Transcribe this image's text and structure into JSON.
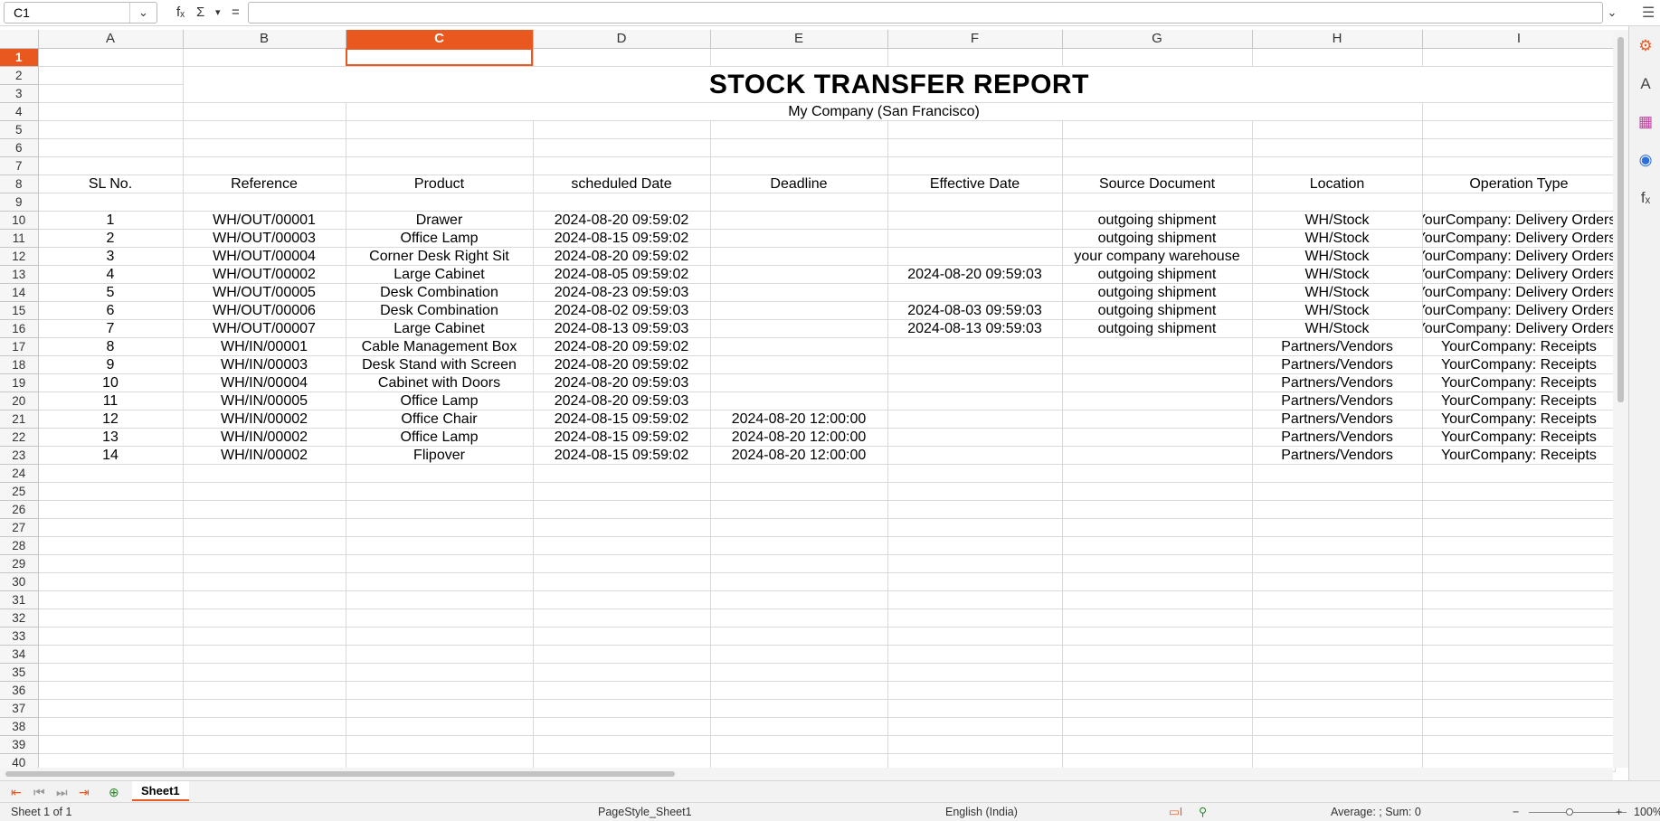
{
  "formula_bar": {
    "cell_ref": "C1",
    "name_box_dropdown": "⌄",
    "fx_label": "fₓ",
    "sum_label": "Σ",
    "sum_dropdown": "▾",
    "equals_label": "=",
    "formula_value": "",
    "expand_label": "⌄"
  },
  "sidebar": {
    "menu": "☰",
    "properties": "⚙",
    "styles": "A",
    "gallery": "▦",
    "navigator": "◉",
    "functions": "fₓ"
  },
  "columns": [
    "A",
    "B",
    "C",
    "D",
    "E",
    "F",
    "G",
    "H",
    "I"
  ],
  "selected_column": "C",
  "selected_row": "1",
  "report": {
    "title": "STOCK TRANSFER REPORT",
    "company": "My Company (San Francisco)"
  },
  "table": {
    "headers": [
      "SL No.",
      "Reference",
      "Product",
      "scheduled Date",
      "Deadline",
      "Effective Date",
      "Source Document",
      "Location",
      "Operation Type"
    ],
    "rows": [
      [
        "1",
        "WH/OUT/00001",
        "Drawer",
        "2024-08-20 09:59:02",
        "",
        "",
        "outgoing shipment",
        "WH/Stock",
        "YourCompany: Delivery Orders"
      ],
      [
        "2",
        "WH/OUT/00003",
        "Office Lamp",
        "2024-08-15 09:59:02",
        "",
        "",
        "outgoing shipment",
        "WH/Stock",
        "YourCompany: Delivery Orders"
      ],
      [
        "3",
        "WH/OUT/00004",
        "Corner Desk Right Sit",
        "2024-08-20 09:59:02",
        "",
        "",
        "your company warehouse",
        "WH/Stock",
        "YourCompany: Delivery Orders"
      ],
      [
        "4",
        "WH/OUT/00002",
        "Large Cabinet",
        "2024-08-05 09:59:02",
        "",
        "2024-08-20 09:59:03",
        "outgoing shipment",
        "WH/Stock",
        "YourCompany: Delivery Orders"
      ],
      [
        "5",
        "WH/OUT/00005",
        "Desk Combination",
        "2024-08-23 09:59:03",
        "",
        "",
        "outgoing shipment",
        "WH/Stock",
        "YourCompany: Delivery Orders"
      ],
      [
        "6",
        "WH/OUT/00006",
        "Desk Combination",
        "2024-08-02 09:59:03",
        "",
        "2024-08-03 09:59:03",
        "outgoing shipment",
        "WH/Stock",
        "YourCompany: Delivery Orders"
      ],
      [
        "7",
        "WH/OUT/00007",
        "Large Cabinet",
        "2024-08-13 09:59:03",
        "",
        "2024-08-13 09:59:03",
        "outgoing shipment",
        "WH/Stock",
        "YourCompany: Delivery Orders"
      ],
      [
        "8",
        "WH/IN/00001",
        "Cable Management Box",
        "2024-08-20 09:59:02",
        "",
        "",
        "",
        "Partners/Vendors",
        "YourCompany: Receipts"
      ],
      [
        "9",
        "WH/IN/00003",
        "Desk Stand with Screen",
        "2024-08-20 09:59:02",
        "",
        "",
        "",
        "Partners/Vendors",
        "YourCompany: Receipts"
      ],
      [
        "10",
        "WH/IN/00004",
        "Cabinet with Doors",
        "2024-08-20 09:59:03",
        "",
        "",
        "",
        "Partners/Vendors",
        "YourCompany: Receipts"
      ],
      [
        "11",
        "WH/IN/00005",
        "Office Lamp",
        "2024-08-20 09:59:03",
        "",
        "",
        "",
        "Partners/Vendors",
        "YourCompany: Receipts"
      ],
      [
        "12",
        "WH/IN/00002",
        "Office Chair",
        "2024-08-15 09:59:02",
        "2024-08-20 12:00:00",
        "",
        "",
        "Partners/Vendors",
        "YourCompany: Receipts"
      ],
      [
        "13",
        "WH/IN/00002",
        "Office Lamp",
        "2024-08-15 09:59:02",
        "2024-08-20 12:00:00",
        "",
        "",
        "Partners/Vendors",
        "YourCompany: Receipts"
      ],
      [
        "14",
        "WH/IN/00002",
        "Flipover",
        "2024-08-15 09:59:02",
        "2024-08-20 12:00:00",
        "",
        "",
        "Partners/Vendors",
        "YourCompany: Receipts"
      ]
    ]
  },
  "sheet_tabs": {
    "active": "Sheet1",
    "nav_first": "⇤",
    "nav_prev": "⏮",
    "nav_next": "⏭",
    "nav_last": "⇥",
    "add_sheet": "⊕"
  },
  "status": {
    "sheet_info": "Sheet 1 of 1",
    "page_style": "PageStyle_Sheet1",
    "language": "English (India)",
    "selection_mode": "▭I",
    "signature": "⚲",
    "summary": "Average: ; Sum: 0",
    "zoom_out": "−",
    "zoom_in": "+",
    "zoom": "100%"
  },
  "accent_color": "#e9591f"
}
